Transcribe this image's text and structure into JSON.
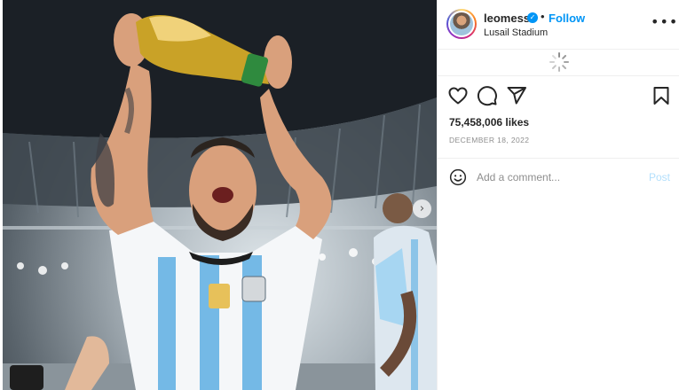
{
  "post": {
    "username": "leomessi",
    "follow_label": "Follow",
    "separator": "•",
    "location": "Lusail Stadium",
    "more_label": "•••",
    "likes": "75,458,006 likes",
    "date": "DECEMBER 18, 2022"
  },
  "carousel": {
    "next_label": "›"
  },
  "comment_box": {
    "placeholder": "Add a comment...",
    "post_label": "Post"
  },
  "icons": {
    "like": "heart-icon",
    "comment": "comment-icon",
    "share": "paper-plane-icon",
    "save": "bookmark-icon",
    "emoji": "emoji-icon",
    "verified": "verified-badge-icon",
    "loading": "spinner-icon"
  },
  "colors": {
    "link_blue": "#0095f6",
    "post_disabled": "#b2dffc",
    "secondary_text": "#8e8e8e",
    "divider": "#efefef"
  }
}
